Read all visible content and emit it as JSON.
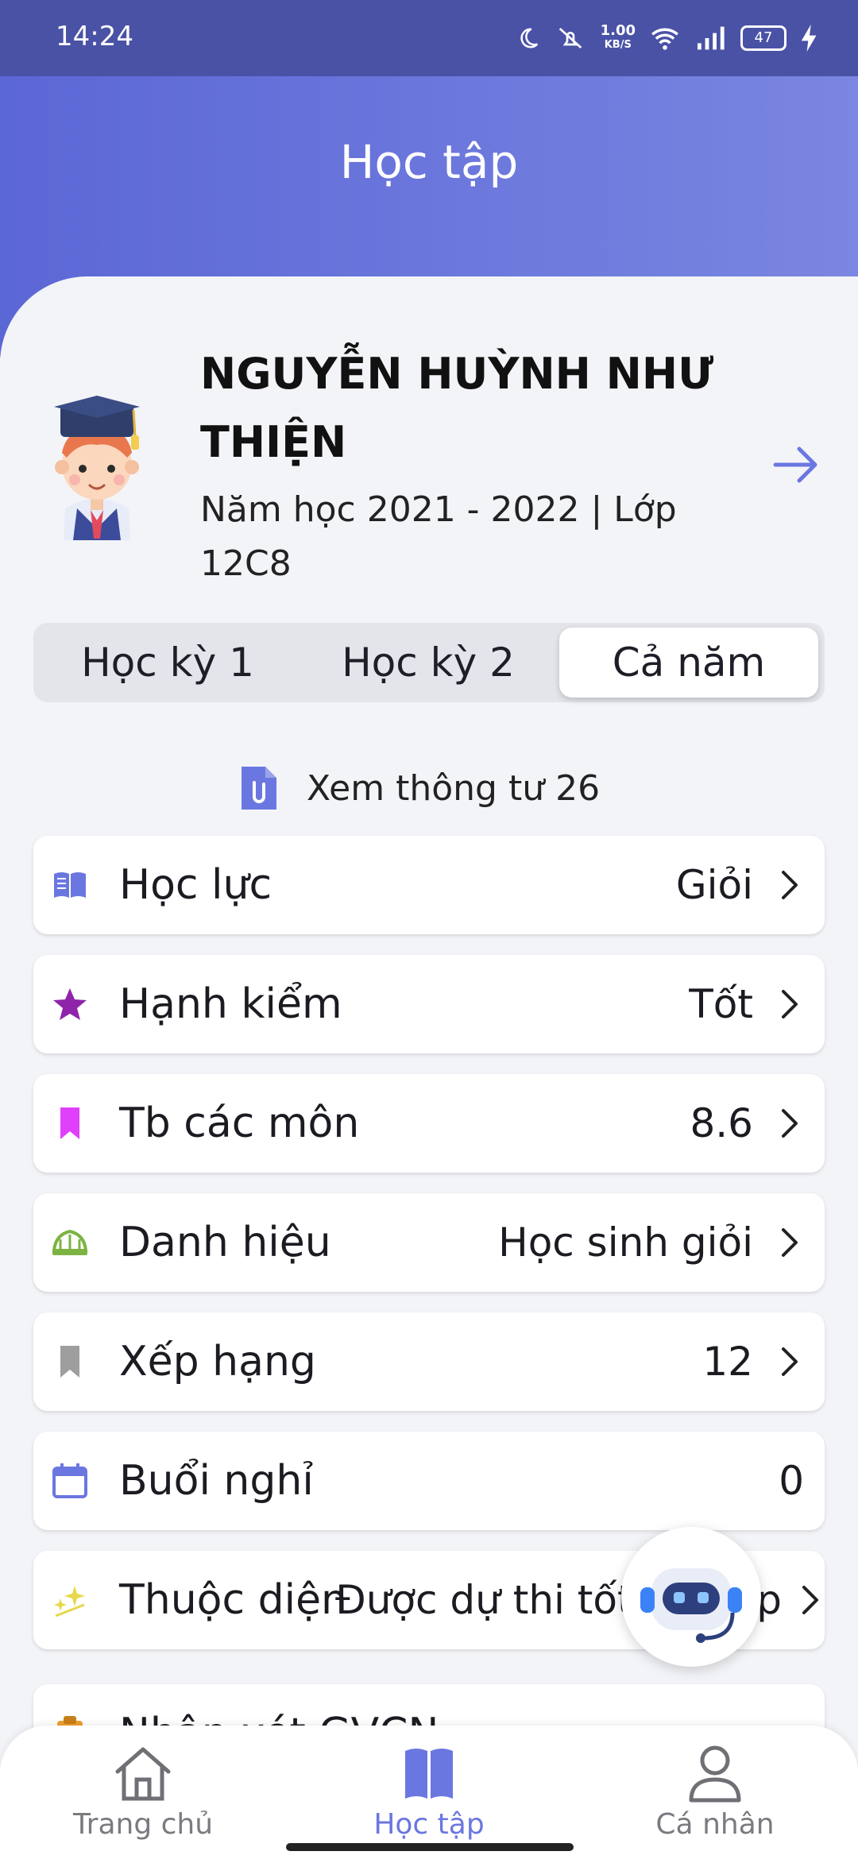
{
  "status_bar": {
    "time": "14:24",
    "net_speed_value": "1.00",
    "net_speed_unit": "KB/S",
    "battery": "47"
  },
  "header": {
    "title": "Học tập"
  },
  "student": {
    "name": "NGUYỄN HUỲNH NHƯ THIỆN",
    "meta": "Năm học 2021 - 2022 | Lớp 12C8"
  },
  "semester_tabs": [
    {
      "label": "Học kỳ 1",
      "active": false
    },
    {
      "label": "Học kỳ 2",
      "active": false
    },
    {
      "label": "Cả năm",
      "active": true
    }
  ],
  "circular_link": "Xem thông tư 26",
  "summary_rows": [
    {
      "label": "Học lực",
      "value": "Giỏi",
      "icon": "book-open-icon",
      "icon_color": "#6b77e0"
    },
    {
      "label": "Hạnh kiểm",
      "value": "Tốt",
      "icon": "star-icon",
      "icon_color": "#8e24aa"
    },
    {
      "label": "Tb các môn",
      "value": "8.6",
      "icon": "bookmark-icon",
      "icon_color": "#e040fb"
    },
    {
      "label": "Danh hiệu",
      "value": "Học sinh giỏi",
      "icon": "laurel-icon",
      "icon_color": "#7cb342"
    },
    {
      "label": "Xếp hạng",
      "value": "12",
      "icon": "bookmark-icon",
      "icon_color": "#9e9e9e"
    },
    {
      "label": "Buổi nghỉ",
      "value": "0",
      "icon": "calendar-icon",
      "icon_color": "#6b77e0"
    },
    {
      "label": "Thuộc diện",
      "value": "Được dự thi tốt nghiệp",
      "icon": "sparkle-icon",
      "icon_color": "#e6d84a"
    }
  ],
  "partial_row": {
    "label": "Nhận xét GVCN",
    "icon": "clipboard-icon",
    "icon_color": "#f0a030"
  },
  "bottom_nav": [
    {
      "label": "Trang chủ",
      "icon": "home-icon",
      "active": false
    },
    {
      "label": "Học tập",
      "icon": "book-icon",
      "active": true
    },
    {
      "label": "Cá nhân",
      "icon": "person-icon",
      "active": false
    }
  ],
  "colors": {
    "accent": "#6b77e0",
    "header_gradient_start": "#5c67d6",
    "status_bar": "#4a52a6"
  }
}
